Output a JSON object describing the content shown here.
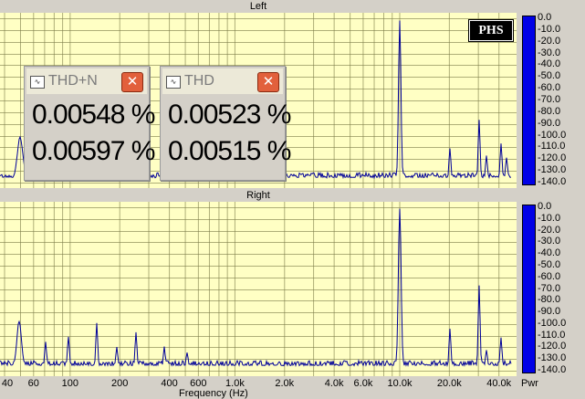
{
  "channels": [
    {
      "title": "Left",
      "id": "left"
    },
    {
      "title": "Right",
      "id": "right"
    }
  ],
  "logo_text": "PHS",
  "meter": {
    "ticks": [
      "0.0",
      "-10.0",
      "-20.0",
      "-30.0",
      "-40.0",
      "-50.0",
      "-60.0",
      "-70.0",
      "-80.0",
      "-90.0",
      "-100.0",
      "-110.0",
      "-120.0",
      "-130.0",
      "-140.0"
    ],
    "label": "Pwr",
    "bar_color": "#0000e6"
  },
  "x_axis": {
    "tick_labels": [
      "40",
      "60",
      "100",
      "200",
      "400",
      "600",
      "1.0k",
      "2.0k",
      "4.0k",
      "6.0k",
      "10.0k",
      "20.0k",
      "40.0k"
    ],
    "title": "Frequency (Hz)"
  },
  "thdn_window": {
    "title": "THD+N",
    "values": [
      "0.00548 %",
      "0.00597 %"
    ]
  },
  "thd_window": {
    "title": "THD",
    "values": [
      "0.00523 %",
      "0.00515 %"
    ]
  },
  "colors": {
    "plot_background": "#ffffc4",
    "grid": "#7a7a46",
    "trace": "#000099"
  }
}
